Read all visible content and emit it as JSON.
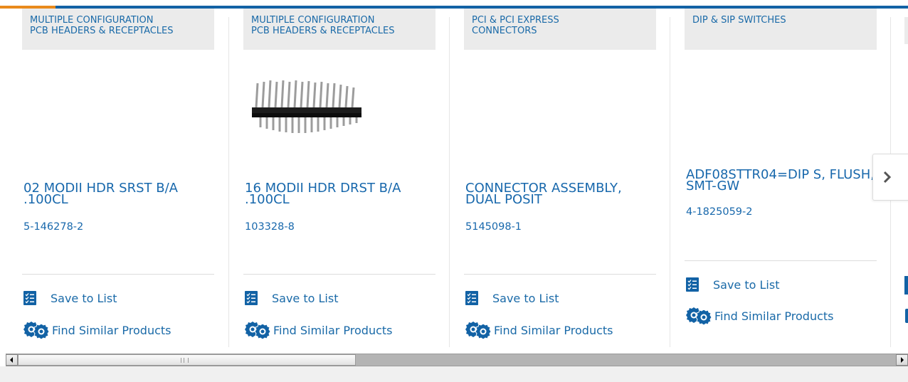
{
  "colors": {
    "brand_blue": "#1262a5",
    "accent_orange": "#e98a1c",
    "link_blue": "#1868ac",
    "category_bg": "#ebebeb"
  },
  "products": [
    {
      "category": "MULTIPLE CONFIGURATION\nPCB HEADERS & RECEPTACLES",
      "title": "02 MODII HDR SRST B/A .100CL",
      "part_number": "5-146278-2",
      "save_label": "Save to List",
      "similar_label": "Find Similar Products"
    },
    {
      "category": "MULTIPLE CONFIGURATION\nPCB HEADERS & RECEPTACLES",
      "title": "16 MODII HDR DRST B/A .100CL",
      "part_number": "103328-8",
      "save_label": "Save to List",
      "similar_label": "Find Similar Products"
    },
    {
      "category": "PCI & PCI EXPRESS\nCONNECTORS",
      "title": "CONNECTOR ASSEMBLY, DUAL POSIT",
      "part_number": "5145098-1",
      "save_label": "Save to List",
      "similar_label": "Find Similar Products"
    },
    {
      "category": "DIP & SIP SWITCHES",
      "title": "ADF08STTR04=DIP S, FLUSH, SMT-GW",
      "part_number": "4-1825059-2",
      "save_label": "Save to List",
      "similar_label": "Find Similar Products"
    }
  ],
  "icons": {
    "next": "chevron-right-icon",
    "save": "checklist-icon",
    "similar": "find-similar-icon",
    "header_image": "pin-header-image"
  }
}
